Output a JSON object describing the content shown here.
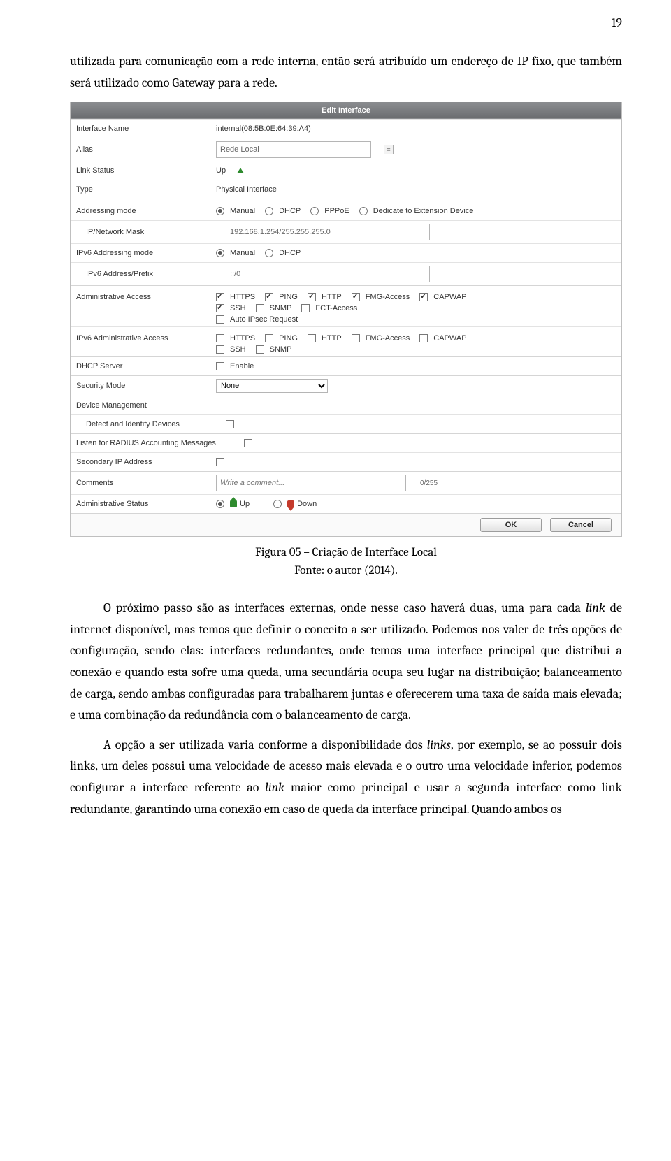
{
  "page": {
    "number": "19"
  },
  "body": {
    "p1": "utilizada para comunicação com a rede interna, então será atribuído um endereço de IP fixo, que também será utilizado como Gateway para a rede.",
    "p2_a": "O próximo passo são as interfaces externas, onde nesse caso haverá duas, uma para cada ",
    "p2_link1": "link",
    "p2_b": " de internet disponível, mas temos que definir o conceito a ser utilizado. Podemos nos valer de três opções de configuração, sendo elas: interfaces redundantes, onde temos uma interface principal que distribui a conexão e quando esta sofre uma queda, uma secundária ocupa seu lugar na distribuição; balanceamento de carga, sendo ambas configuradas para trabalharem juntas e oferecerem uma taxa de saída mais elevada; e uma combinação da redundância com o balanceamento de carga.",
    "p3_a": "A opção a ser utilizada varia conforme a disponibilidade dos ",
    "p3_link1": "links",
    "p3_b": ", por exemplo, se ao possuir dois links, um deles possui uma velocidade de acesso mais elevada e o outro uma velocidade inferior, podemos configurar a interface referente ao ",
    "p3_link2": "link",
    "p3_c": " maior como principal e usar a segunda interface como link redundante, garantindo uma conexão em caso de queda da interface principal. Quando ambos os"
  },
  "caption": {
    "title": "Figura 05 – Criação de Interface Local",
    "source": "Fonte: o autor (2014)."
  },
  "form": {
    "headerTitle": "Edit Interface",
    "labels": {
      "ifname": "Interface Name",
      "alias": "Alias",
      "linkStatus": "Link Status",
      "type": "Type",
      "addrMode": "Addressing mode",
      "ipMask": "IP/Network Mask",
      "ipv6Mode": "IPv6 Addressing mode",
      "ipv6Prefix": "IPv6 Address/Prefix",
      "adminAccess": "Administrative Access",
      "ipv6AdminAccess": "IPv6 Administrative Access",
      "dhcpServer": "DHCP Server",
      "secMode": "Security Mode",
      "devMgmt": "Device Management",
      "detect": "Detect and Identify Devices",
      "radius": "Listen for RADIUS Accounting Messages",
      "secondaryIp": "Secondary IP Address",
      "comments": "Comments",
      "adminStatus": "Administrative Status"
    },
    "values": {
      "ifname": "internal(08:5B:0E:64:39:A4)",
      "alias": "Rede Local",
      "linkStatus": "Up",
      "type": "Physical Interface",
      "ipMask": "192.168.1.254/255.255.255.0",
      "ipv6Prefix": "::/0",
      "secMode": "None",
      "commentsPlaceholder": "Write a comment...",
      "commentsCounter": "0/255"
    },
    "opts": {
      "manual": "Manual",
      "dhcp": "DHCP",
      "pppoe": "PPPoE",
      "dedicate": "Dedicate to Extension Device",
      "https": "HTTPS",
      "ping": "PING",
      "http": "HTTP",
      "fmg": "FMG-Access",
      "capwap": "CAPWAP",
      "ssh": "SSH",
      "snmp": "SNMP",
      "fct": "FCT-Access",
      "autoipsec": "Auto IPsec Request",
      "enable": "Enable",
      "up": "Up",
      "down": "Down"
    },
    "buttons": {
      "ok": "OK",
      "cancel": "Cancel"
    }
  }
}
